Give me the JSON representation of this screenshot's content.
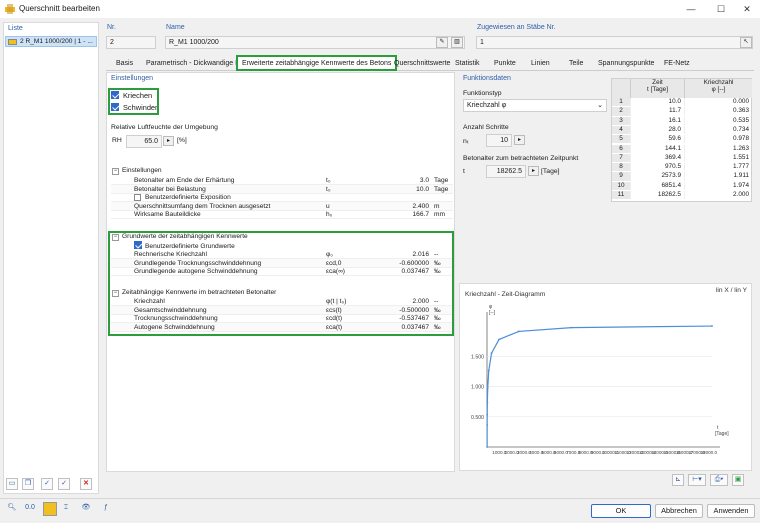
{
  "window": {
    "title": "Querschnitt bearbeiten",
    "min": "—",
    "max": "☐",
    "close": "✕"
  },
  "liste": {
    "label": "Liste",
    "item": "2  R_M1 1000/200 | 1 - ..."
  },
  "nr": {
    "label": "Nr.",
    "value": "2"
  },
  "name": {
    "label": "Name",
    "value": "R_M1 1000/200"
  },
  "assigned": {
    "label": "Zugewiesen an Stäbe Nr.",
    "value": "1"
  },
  "tabs": [
    "Basis",
    "Parametrisch - Dickwandige I",
    "Erweiterte zeitabhängige Kennwerte des Betons",
    "Querschnittswerte",
    "Statistik",
    "Punkte",
    "Linien",
    "Teile",
    "Spannungspunkte",
    "FE-Netz"
  ],
  "einstellungen": {
    "header": "Einstellungen",
    "kriechen": "Kriechen",
    "schwinden": "Schwinden",
    "rh_label": "Relative Luftfeuchte der Umgebung",
    "rh_sym": "RH",
    "rh_value": "65.0",
    "rh_unit": "[%]"
  },
  "grid1": {
    "title": "Einstellungen",
    "rows": [
      {
        "label": "Betonalter am Ende der Erhärtung",
        "sym": "t₀",
        "val": "3.0",
        "unit": "Tage"
      },
      {
        "label": "Betonalter bei Belastung",
        "sym": "t₀",
        "val": "10.0",
        "unit": "Tage"
      },
      {
        "label": "Benutzerdefinierte Exposition",
        "sym": "",
        "val": "",
        "unit": ""
      },
      {
        "label": "Querschnittsumfang dem Trocknen ausgesetzt",
        "sym": "u",
        "val": "2.400",
        "unit": "m"
      },
      {
        "label": "Wirksame Bauteildicke",
        "sym": "h₀",
        "val": "166.7",
        "unit": "mm"
      }
    ]
  },
  "grid2": {
    "title": "Grundwerte der zeitabhängigen Kennwerte",
    "check": "Benutzerdefinierte Grundwerte",
    "rows": [
      {
        "label": "Rechnerische Kriechzahl",
        "sym": "φ₀",
        "val": "2.016",
        "unit": "--"
      },
      {
        "label": "Grundlegende Trocknungsschwinddehnung",
        "sym": "εcd,0",
        "val": "-0.600000",
        "unit": "‰"
      },
      {
        "label": "Grundlegende autogene Schwinddehnung",
        "sym": "εca(∞)",
        "val": "0.037467",
        "unit": "‰"
      }
    ]
  },
  "grid3": {
    "title": "Zeitabhängige Kennwerte im betrachteten Betonalter",
    "rows": [
      {
        "label": "Kriechzahl",
        "sym": "φ(t | t₀)",
        "val": "2.000",
        "unit": "--"
      },
      {
        "label": "Gesamtschwinddehnung",
        "sym": "εcs(t)",
        "val": "-0.500000",
        "unit": "‰"
      },
      {
        "label": "Trocknungsschwinddehnung",
        "sym": "εcd(t)",
        "val": "-0.537467",
        "unit": "‰"
      },
      {
        "label": "Autogene Schwinddehnung",
        "sym": "εca(t)",
        "val": "0.037467",
        "unit": "‰"
      }
    ]
  },
  "funktion": {
    "header": "Funktionsdaten",
    "typ_label": "Funktionstyp",
    "typ_value": "Kriechzahl φ",
    "steps_label": "Anzahl Schritte",
    "steps_sym": "nₜ",
    "steps_value": "10",
    "age_label": "Betonalter zum betrachteten Zeitpunkt",
    "age_sym": "t",
    "age_value": "18262.5",
    "age_unit": "[Tage]"
  },
  "table": {
    "col1": "Zeit",
    "col1b": "t [Tage]",
    "col2": "Kriechzahl",
    "col2b": "φ [--]",
    "rows": [
      [
        "1",
        "10.0",
        "0.000"
      ],
      [
        "2",
        "11.7",
        "0.363"
      ],
      [
        "3",
        "16.1",
        "0.535"
      ],
      [
        "4",
        "28.0",
        "0.734"
      ],
      [
        "5",
        "59.6",
        "0.978"
      ],
      [
        "6",
        "144.1",
        "1.263"
      ],
      [
        "7",
        "369.4",
        "1.551"
      ],
      [
        "8",
        "970.5",
        "1.777"
      ],
      [
        "9",
        "2573.9",
        "1.911"
      ],
      [
        "10",
        "6851.4",
        "1.974"
      ],
      [
        "11",
        "18262.5",
        "2.000"
      ]
    ]
  },
  "chart_data": {
    "type": "line",
    "title": "Kriechzahl - Zeit-Diagramm",
    "scale_label": "lin X / lin Y",
    "ylabel_top": "φ",
    "ylabel_unit": "[--]",
    "xlabel": "t",
    "xlabel_unit": "[Tage]",
    "yticks": [
      "1.500",
      "1.000",
      "0.500"
    ],
    "xticks": [
      "1000.0",
      "2000.0",
      "3000.0",
      "4000.0",
      "5000.0",
      "6000.0",
      "7000.0",
      "8000.0",
      "9000.0",
      "10000.0",
      "11000.0",
      "12000.0",
      "13000.0",
      "14000.0",
      "15000.0",
      "16000.0",
      "17000.0",
      "18000.0"
    ],
    "xlim": [
      0,
      18262.5
    ],
    "ylim": [
      0,
      2.1
    ],
    "color": "#4a8fd8",
    "series": [
      {
        "x": [
          10.0,
          11.7,
          16.1,
          28.0,
          59.6,
          144.1,
          369.4,
          970.5,
          2573.9,
          6851.4,
          18262.5
        ],
        "y": [
          0.0,
          0.363,
          0.535,
          0.734,
          0.978,
          1.263,
          1.551,
          1.777,
          1.911,
          1.974,
          2.0
        ]
      }
    ]
  },
  "buttons": {
    "ok": "OK",
    "cancel": "Abbrechen",
    "apply": "Anwenden"
  }
}
